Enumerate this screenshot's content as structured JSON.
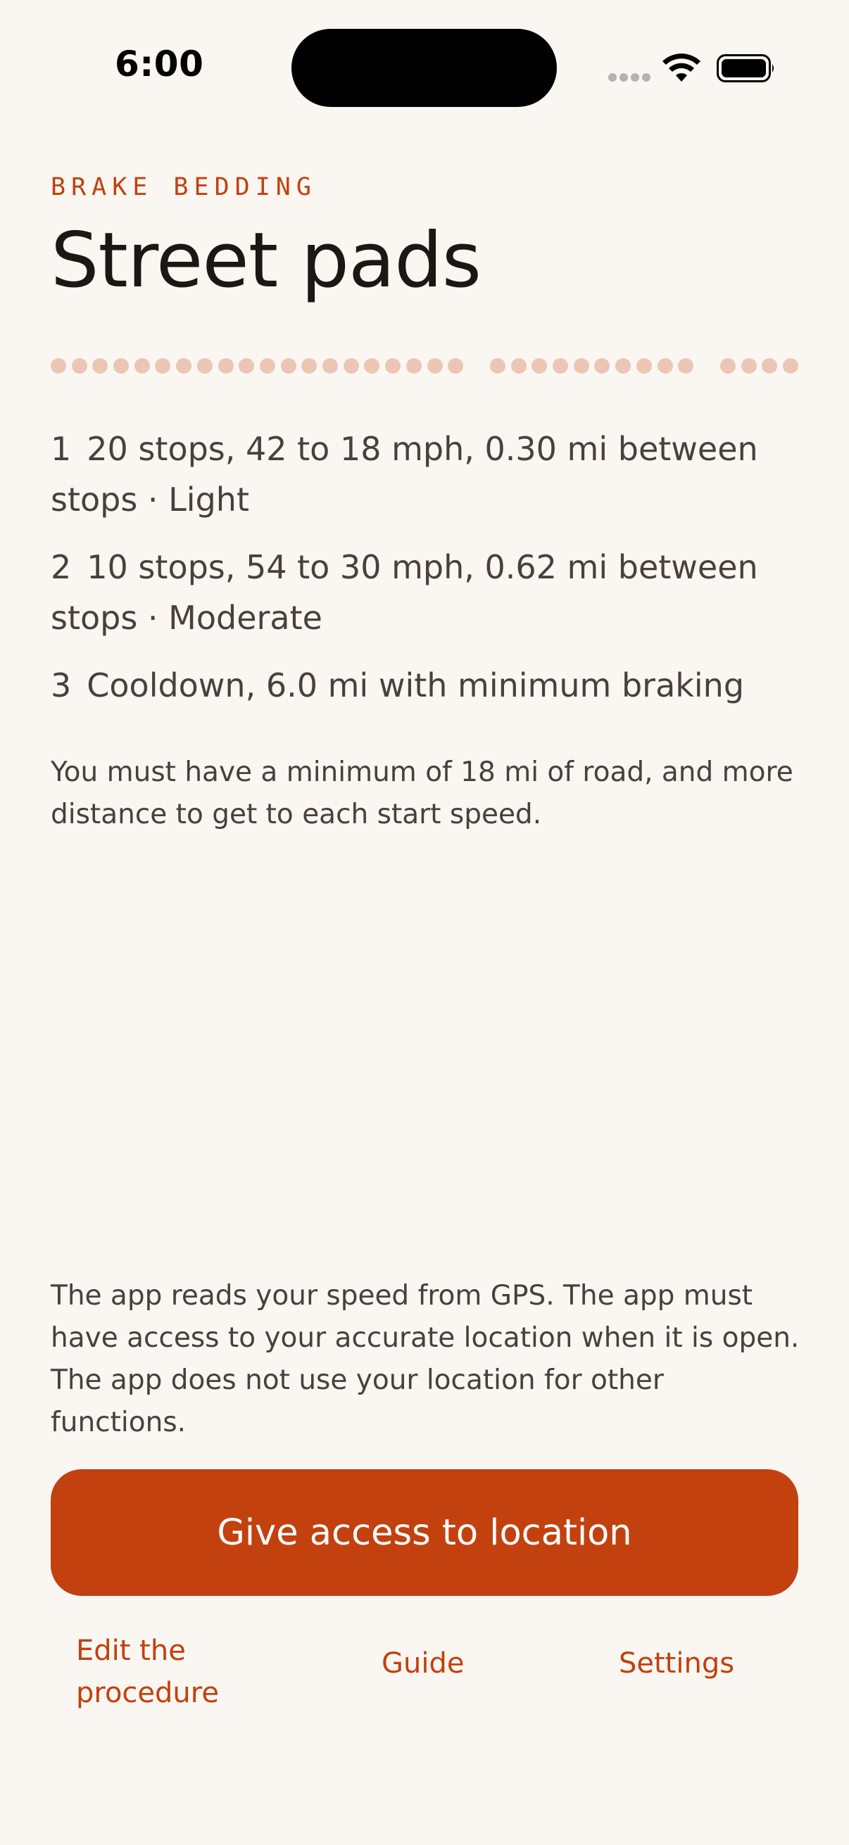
{
  "status_bar": {
    "time": "6:00"
  },
  "header": {
    "eyebrow": "BRAKE BEDDING",
    "title": "Street pads"
  },
  "timeline": {
    "groups": [
      20,
      10,
      4
    ],
    "color": "#ecc6b5"
  },
  "steps": [
    {
      "number": "1",
      "text": "20 stops, 42 to 18 mph, 0.30 mi between stops · Light"
    },
    {
      "number": "2",
      "text": "10 stops, 54 to 30 mph, 0.62 mi between stops · Moderate"
    },
    {
      "number": "3",
      "text": "Cooldown, 6.0 mi with minimum braking"
    }
  ],
  "note": "You must have a minimum of 18 mi of road, and more distance to get to each start speed.",
  "location_info": "The app reads your speed from GPS. The app must have access to your accurate location when it is open. The app does not use your location for other functions.",
  "primary_button": "Give access to location",
  "bottom_links": {
    "edit": "Edit the procedure",
    "guide": "Guide",
    "settings": "Settings"
  },
  "colors": {
    "accent": "#c2410c",
    "background": "#faf6f2",
    "text": "#4a403a",
    "title": "#1c1714"
  },
  "icons": [
    "cellular-signal-icon",
    "wifi-icon",
    "battery-icon"
  ]
}
